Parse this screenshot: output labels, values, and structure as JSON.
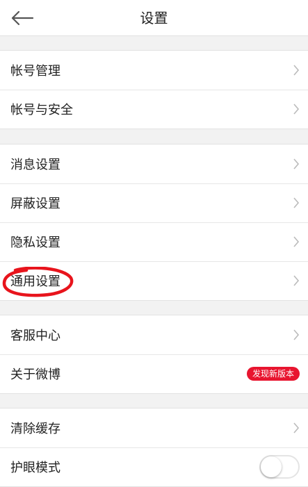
{
  "header": {
    "title": "设置",
    "back_icon": "arrow-left-icon"
  },
  "groups": [
    {
      "items": [
        {
          "label": "帐号管理",
          "accessory": "chevron"
        },
        {
          "label": "帐号与安全",
          "accessory": "chevron"
        }
      ]
    },
    {
      "items": [
        {
          "label": "消息设置",
          "accessory": "chevron"
        },
        {
          "label": "屏蔽设置",
          "accessory": "chevron"
        },
        {
          "label": "隐私设置",
          "accessory": "chevron"
        },
        {
          "label": "通用设置",
          "accessory": "chevron"
        }
      ]
    },
    {
      "items": [
        {
          "label": "客服中心",
          "accessory": "chevron"
        },
        {
          "label": "关于微博",
          "accessory": "badge",
          "badge_text": "发现新版本"
        }
      ]
    },
    {
      "items": [
        {
          "label": "清除缓存",
          "accessory": "chevron"
        },
        {
          "label": "护眼模式",
          "accessory": "toggle",
          "toggle_on": false
        }
      ]
    }
  ],
  "colors": {
    "background": "#f2f2f2",
    "badge": "#e8152f",
    "annotation": "#e8141c",
    "chevron": "#bbbbbb"
  }
}
